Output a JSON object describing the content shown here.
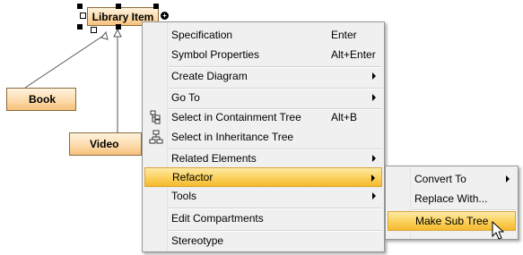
{
  "diagram": {
    "library_item": "Library Item",
    "book": "Book",
    "video": "Video"
  },
  "context_menu": {
    "items": [
      {
        "label": "Specification",
        "shortcut": "Enter"
      },
      {
        "label": "Symbol Properties",
        "shortcut": "Alt+Enter"
      },
      {
        "label": "Create Diagram"
      },
      {
        "label": "Go To"
      },
      {
        "label": "Select in Containment Tree",
        "shortcut": "Alt+B",
        "icon": "containment-tree-icon"
      },
      {
        "label": "Select in Inheritance Tree",
        "icon": "inheritance-tree-icon"
      },
      {
        "label": "Related Elements"
      },
      {
        "label": "Refactor",
        "highlighted": true
      },
      {
        "label": "Tools"
      },
      {
        "label": "Edit Compartments"
      },
      {
        "label": "Stereotype"
      }
    ]
  },
  "submenu": {
    "items": [
      {
        "label": "Convert To"
      },
      {
        "label": "Replace With..."
      },
      {
        "label": "Make Sub Tree",
        "highlighted": true
      }
    ]
  },
  "colors": {
    "highlight": "#fbd361",
    "menu_bg": "#f0f0f0",
    "box_fill": "#fcd9a8"
  },
  "icons": {
    "cursor": "mouse-pointer-icon"
  }
}
